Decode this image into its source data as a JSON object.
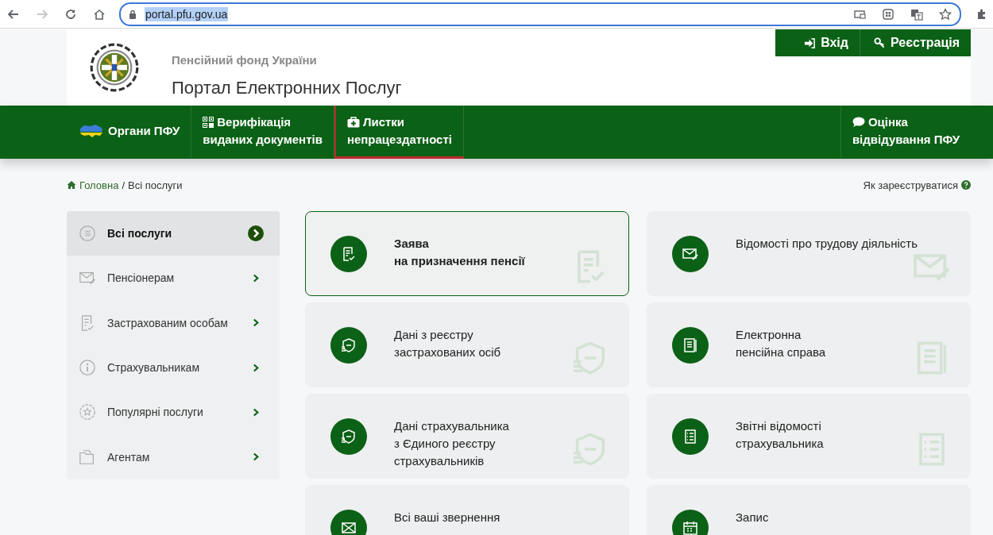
{
  "browser": {
    "address": "portal.pfu.gov.ua",
    "address_selected": true,
    "forward_disabled": true
  },
  "header": {
    "org_name": "Пенсійний фонд України",
    "portal_title": "Портал Електронних Послуг",
    "auth_buttons": [
      "Вхід",
      "Реєстрація"
    ]
  },
  "nav": {
    "items": [
      {
        "label": "Органи ПФУ",
        "selected": false
      },
      {
        "label": "Верифікація\nвиданих документів",
        "selected": false
      },
      {
        "label": "Листки\nнепрацездатності",
        "selected": true
      }
    ],
    "right_item": {
      "label": "Оцінка\nвідвідування ПФУ"
    }
  },
  "breadcrumb": {
    "home": "Головна",
    "separator": "/",
    "current": "Всі послуги",
    "help_link": "Як зареєструватися"
  },
  "sidebar": {
    "items": [
      {
        "label": "Всі послуги",
        "selected": true
      },
      {
        "label": "Пенсіонерам",
        "selected": false
      },
      {
        "label": "Застрахованим особам",
        "selected": false
      },
      {
        "label": "Страхувальникам",
        "selected": false
      },
      {
        "label": "Популярні послуги",
        "selected": false
      },
      {
        "label": "Агентам",
        "selected": false
      }
    ]
  },
  "services": [
    {
      "title": "Заява\nна призначення пенсії",
      "selected": true
    },
    {
      "title": "Відомості про трудову діяльність",
      "selected": false
    },
    {
      "title": "Дані з реєстру\nзастрахованих осіб",
      "selected": false
    },
    {
      "title": "Електронна\nпенсійна справа",
      "selected": false
    },
    {
      "title": "Дані страхувальника\nз Єдиного реєстру\nстрахувальників",
      "selected": false
    },
    {
      "title": "Звітні відомості\nстрахувальника",
      "selected": false
    },
    {
      "title": "Всі ваші звернення",
      "selected": false
    },
    {
      "title": "Запис",
      "selected": false
    }
  ]
}
